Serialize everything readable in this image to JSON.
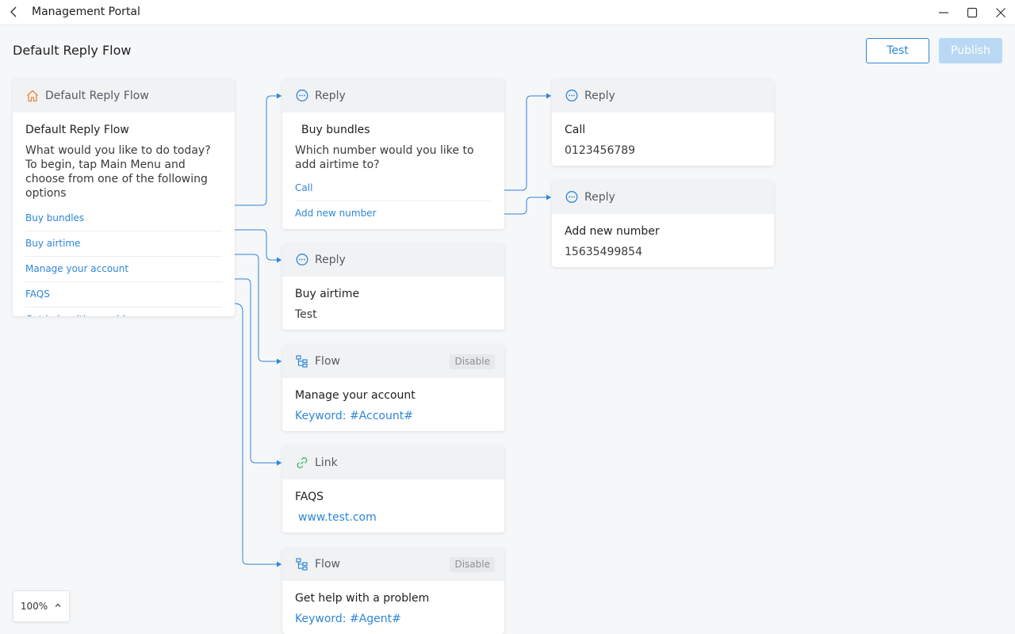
{
  "window": {
    "title": "Management Portal"
  },
  "header": {
    "title": "Default Reply Flow",
    "test_label": "Test",
    "publish_label": "Publish"
  },
  "root_card": {
    "head": "Default Reply Flow",
    "title": "Default Reply Flow",
    "message": "What would you like to do today? To begin, tap Main Menu and choose from one of the following options",
    "options": [
      "Buy bundles",
      "Buy airtime",
      "Manage your account",
      "FAQS",
      "Get help with a problem"
    ]
  },
  "cards": {
    "buy_bundles": {
      "type": "Reply",
      "icon": "chat-bubble-icon",
      "title": "Buy bundles",
      "message": "Which number would you like to add airtime to?",
      "options": [
        "Call",
        "Add new number"
      ]
    },
    "buy_airtime": {
      "type": "Reply",
      "icon": "chat-bubble-icon",
      "title": "Buy airtime",
      "message": "Test"
    },
    "manage_account": {
      "type": "Flow",
      "icon": "flow-tree-icon",
      "badge": "Disable",
      "title": "Manage your account",
      "keyword": "Keyword: #Account#"
    },
    "faqs": {
      "type": "Link",
      "icon": "link-icon",
      "title": "FAQS",
      "url": "www.test.com"
    },
    "get_help": {
      "type": "Flow",
      "icon": "flow-tree-icon",
      "badge": "Disable",
      "title": "Get help with a problem",
      "keyword": "Keyword: #Agent#"
    },
    "call": {
      "type": "Reply",
      "icon": "chat-bubble-icon",
      "title": "Call",
      "message": "0123456789"
    },
    "add_number": {
      "type": "Reply",
      "icon": "chat-bubble-icon",
      "title": "Add new number",
      "message": "15635499854"
    }
  },
  "zoom": {
    "level": "100%"
  },
  "colors": {
    "accent": "#2f86d6",
    "home_icon": "#e8893a",
    "link_icon": "#3cb371",
    "canvas": "#f6f7f9"
  }
}
